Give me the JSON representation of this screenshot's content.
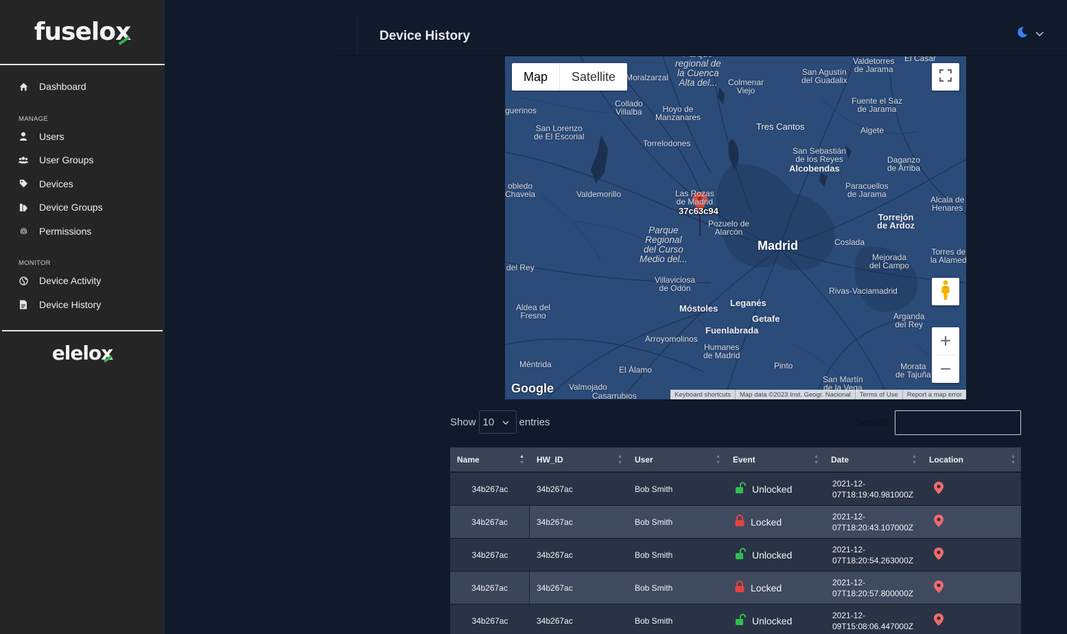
{
  "sidebar": {
    "logo": "fuselox",
    "items_top": [
      {
        "label": "Dashboard",
        "icon": "home-icon"
      }
    ],
    "manage_title": "MANAGE",
    "manage": [
      {
        "label": "Users",
        "icon": "user-icon"
      },
      {
        "label": "User Groups",
        "icon": "users-icon"
      },
      {
        "label": "Devices",
        "icon": "tag-icon"
      },
      {
        "label": "Device Groups",
        "icon": "tags-icon"
      },
      {
        "label": "Permissions",
        "icon": "fingerprint-icon"
      }
    ],
    "monitor_title": "MONITOR",
    "monitor": [
      {
        "label": "Device Activity",
        "icon": "globe-icon"
      },
      {
        "label": "Device History",
        "icon": "file-icon"
      }
    ],
    "footer_logo": "elelox"
  },
  "header": {
    "title": "Device History"
  },
  "map": {
    "type_map": "Map",
    "type_satellite": "Satellite",
    "marker_label": "37c63c94",
    "google": "Google",
    "attribution": [
      "Keyboard shortcuts",
      "Map data ©2023 Inst. Geogr. Nacional",
      "Terms of Use",
      "Report a map error"
    ],
    "places": {
      "madrid": "Madrid",
      "parque_regional": "Parque\nregional de\nla Cuenca\nAlta del...",
      "moralzarzal": "Moralzarzal",
      "colmenar": "Colmenar\nViejo",
      "san_agustin": "San Agustín\ndel Guadalix",
      "valdetorres": "Valdetorres\nde Jarama",
      "el_casar": "El Casar",
      "fuente_el_saz": "Fuente el Saz\nde Jarama",
      "algete": "Algete",
      "guerinos": "guerinos",
      "collado": "Collado\nVillalba",
      "hoyo": "Hoyo de\nManzanares",
      "tres_cantos": "Tres Cantos",
      "san_lorenzo": "San Lorenzo\nde El Escorial",
      "torrelodones": "Torrelodones",
      "san_sebastian": "San Sebastián\nde los Reyes",
      "alcobendas": "Alcobendas",
      "daganzo": "Daganzo\nde Arriba",
      "robledo": "obledo\nChavela",
      "valdemorillo": "Valdemorillo",
      "las_rozas": "Las Rozas\nde Madrid",
      "paracuellos": "Paracuellos\nde Jarama",
      "alcala": "Alcala de\nHenares",
      "torrejon": "Torrejón\nde Ardoz",
      "pozuelo": "Pozuelo de\nAlarcón",
      "parque_curso": "Parque\nRegional\ndel Curso\nMedio del...",
      "coslada": "Coslada",
      "del_rey": "del Rey",
      "mejorada": "Mejorada\ndel Campo",
      "torres": "Torres de\nla Alamed",
      "villaviciosa": "Villaviciosa\nde Odón",
      "rivas": "Rivas-Vaciamadrid",
      "aldea": "Aldea del\nFresno",
      "mostoles": "Móstoles",
      "leganes": "Leganés",
      "getafe": "Getafe",
      "arganda": "Arganda\ndel Rey",
      "arroyomolinos": "Arroyomolinos",
      "fuenlabrada": "Fuenlabrada",
      "humanes": "Humanes\nde Madrid",
      "mentrida": "Méntrida",
      "el_alamo": "El Álamo",
      "pinto": "Pinto",
      "morata": "Morata\nde Tajuña",
      "valmojado": "Valmojado",
      "casarrubios": "Casarrubios",
      "san_martin": "San Martín\nde la Vega"
    }
  },
  "table_controls": {
    "show_label": "Show",
    "entries_value": "10",
    "entries_label": "entries",
    "search_label": "Search:"
  },
  "table": {
    "columns": [
      "Name",
      "HW_ID",
      "User",
      "Event",
      "Date",
      "Location"
    ],
    "rows": [
      {
        "name": "34b267ac",
        "hw_id": "34b267ac",
        "user": "Bob Smith",
        "event": "Unlocked",
        "date": "2021-12-\n07T18:19:40.981000Z"
      },
      {
        "name": "34b267ac",
        "hw_id": "34b267ac",
        "user": "Bob Smith",
        "event": "Locked",
        "date": "2021-12-\n07T18:20:43.107000Z"
      },
      {
        "name": "34b267ac",
        "hw_id": "34b267ac",
        "user": "Bob Smith",
        "event": "Unlocked",
        "date": "2021-12-\n07T18:20:54.263000Z"
      },
      {
        "name": "34b267ac",
        "hw_id": "34b267ac",
        "user": "Bob Smith",
        "event": "Locked",
        "date": "2021-12-\n07T18:20:57.800000Z"
      },
      {
        "name": "34b267ac",
        "hw_id": "34b267ac",
        "user": "Bob Smith",
        "event": "Unlocked",
        "date": "2021-12-\n09T15:08:06.447000Z"
      }
    ]
  },
  "colors": {
    "unlocked": "#2fbf4f",
    "locked": "#e5423f",
    "location_pin": "#ef6b6b",
    "theme_moon": "#3b82f6"
  }
}
